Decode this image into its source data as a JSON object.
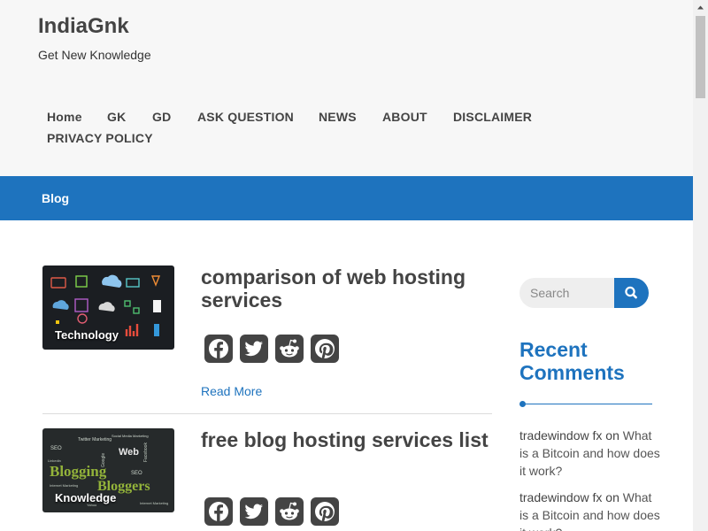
{
  "site": {
    "title": "IndiaGnk",
    "tagline": "Get New Knowledge"
  },
  "nav": [
    {
      "label": "Home"
    },
    {
      "label": "GK"
    },
    {
      "label": "GD"
    },
    {
      "label": "ASK QUESTION"
    },
    {
      "label": "NEWS"
    },
    {
      "label": "ABOUT"
    },
    {
      "label": "DISCLAIMER"
    },
    {
      "label": "PRIVACY POLICY"
    }
  ],
  "page_bar": {
    "title": "Blog"
  },
  "posts": [
    {
      "title": "comparison of web hosting services",
      "category": "Technology",
      "read_more": "Read More",
      "share": [
        "facebook-icon",
        "twitter-icon",
        "reddit-icon",
        "pinterest-icon"
      ]
    },
    {
      "title": "free blog hosting services list",
      "category": "Knowledge",
      "thumb_words": [
        "Blogging",
        "Bloggers",
        "Web",
        "SEO",
        "Twitter Marketing",
        "Social Media Marketing",
        "Internet Marketing",
        "Facebook",
        "Google",
        "Linkedin",
        "Yahoo"
      ],
      "share": [
        "facebook-icon",
        "twitter-icon",
        "reddit-icon",
        "pinterest-icon"
      ]
    }
  ],
  "sidebar": {
    "search": {
      "placeholder": "Search"
    },
    "recent_comments": {
      "title": "Recent Comments",
      "items": [
        {
          "author": "tradewindow fx",
          "on": "on",
          "link": "What is a Bitcoin and how does it work?"
        },
        {
          "author": "tradewindow fx",
          "on": "on",
          "link": "What is a Bitcoin and how does it work?"
        }
      ]
    }
  },
  "colors": {
    "accent": "#1e73be",
    "header_bg": "#f7f7f7",
    "text": "#444444"
  }
}
